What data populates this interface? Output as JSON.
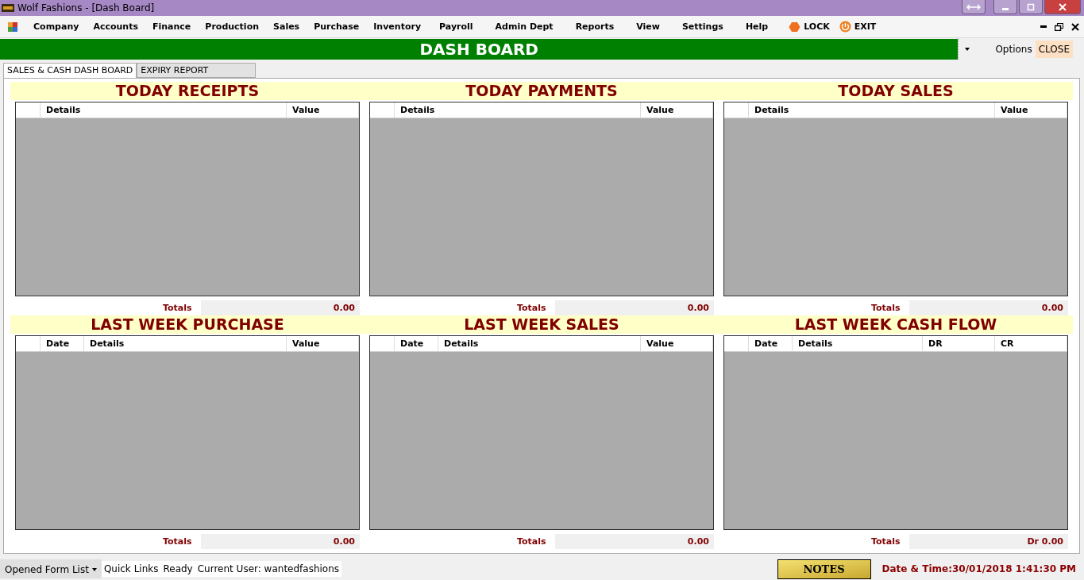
{
  "window": {
    "title": "Wolf Fashions - [Dash Board]"
  },
  "menu": [
    {
      "label": "Company"
    },
    {
      "label": "Accounts"
    },
    {
      "label": "Finance"
    },
    {
      "label": "Production"
    },
    {
      "label": "Sales"
    },
    {
      "label": "Purchase"
    },
    {
      "label": "Inventory"
    },
    {
      "label": "Payroll"
    },
    {
      "label": "Admin Dept"
    },
    {
      "label": "Reports"
    },
    {
      "label": "View"
    },
    {
      "label": "Settings"
    },
    {
      "label": "Help"
    }
  ],
  "menu_actions": [
    {
      "kind": "lock",
      "label": "LOCK"
    },
    {
      "kind": "exit",
      "label": "EXIT"
    }
  ],
  "header": {
    "title": "DASH BOARD",
    "options": "Options",
    "close": "CLOSE"
  },
  "tabs": [
    {
      "label": "SALES & CASH DASH BOARD",
      "selected": true
    },
    {
      "label": "EXPIRY REPORT",
      "selected": false
    }
  ],
  "panels": [
    {
      "title": "TODAY RECEIPTS",
      "columns": [
        {
          "kind": "details",
          "label": "Details"
        },
        {
          "kind": "amount",
          "label": "Value"
        }
      ],
      "totals_label": "Totals",
      "total": "0.00"
    },
    {
      "title": "TODAY PAYMENTS",
      "columns": [
        {
          "kind": "details",
          "label": "Details"
        },
        {
          "kind": "amount",
          "label": "Value"
        }
      ],
      "totals_label": "Totals",
      "total": "0.00"
    },
    {
      "title": "TODAY SALES",
      "columns": [
        {
          "kind": "details",
          "label": "Details"
        },
        {
          "kind": "amount",
          "label": "Value"
        }
      ],
      "totals_label": "Totals",
      "total": "0.00"
    },
    {
      "title": "LAST WEEK PURCHASE",
      "columns": [
        {
          "kind": "date",
          "label": "Date"
        },
        {
          "kind": "details",
          "label": "Details"
        },
        {
          "kind": "amount",
          "label": "Value"
        }
      ],
      "totals_label": "Totals",
      "total": "0.00"
    },
    {
      "title": "LAST WEEK SALES",
      "columns": [
        {
          "kind": "date",
          "label": "Date"
        },
        {
          "kind": "details",
          "label": "Details"
        },
        {
          "kind": "amount",
          "label": "Value"
        }
      ],
      "totals_label": "Totals",
      "total": "0.00"
    },
    {
      "title": "LAST WEEK CASH FLOW",
      "columns": [
        {
          "kind": "date",
          "label": "Date"
        },
        {
          "kind": "details",
          "label": "Details"
        },
        {
          "kind": "amount",
          "label": "DR"
        },
        {
          "kind": "amount",
          "label": "CR"
        }
      ],
      "totals_label": "Totals",
      "total": "Dr 0.00"
    }
  ],
  "status_bar": {
    "form_list": "Opened Form List",
    "quick_links": "Quick Links",
    "status": "Ready",
    "user": "Current User: wantedfashions",
    "notes": "NOTES",
    "datetime": "Date & Time:30/01/2018 1:41:30 PM"
  }
}
